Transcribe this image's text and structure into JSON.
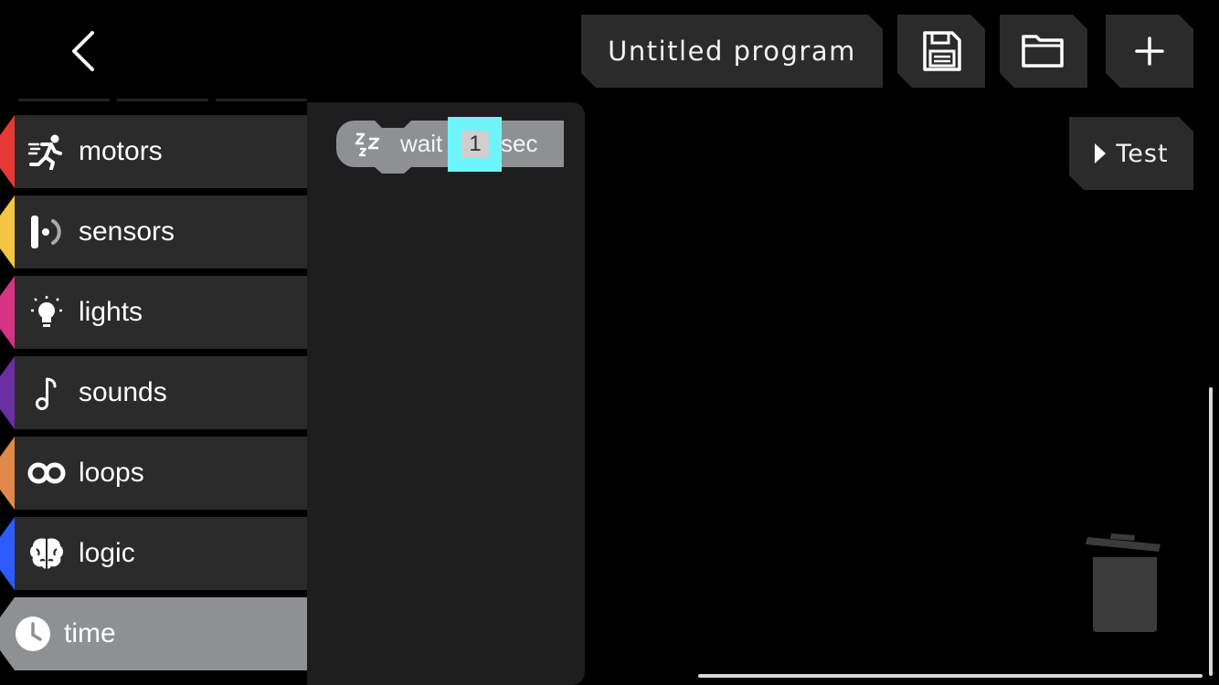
{
  "header": {
    "program_title": "Untitled program",
    "back_icon": "chevron-left-icon",
    "save_icon": "floppy-disk-icon",
    "open_icon": "folder-icon",
    "new_icon": "plus-icon"
  },
  "test_button": {
    "label": "Test",
    "icon": "play-icon"
  },
  "categories": [
    {
      "label": "motors",
      "icon": "running-person-icon",
      "color": "#e53935"
    },
    {
      "label": "sensors",
      "icon": "sensor-icon",
      "color": "#f4c542"
    },
    {
      "label": "lights",
      "icon": "lightbulb-icon",
      "color": "#d63384"
    },
    {
      "label": "sounds",
      "icon": "music-note-icon",
      "color": "#6a2fa0"
    },
    {
      "label": "loops",
      "icon": "infinity-loop-icon",
      "color": "#e0884a"
    },
    {
      "label": "logic",
      "icon": "brain-icon",
      "color": "#2d5bff"
    },
    {
      "label": "time",
      "icon": "clock-icon",
      "color": "#8d9193",
      "active": true
    }
  ],
  "flyout": {
    "blocks": [
      {
        "icon": "sleep-zzz-icon",
        "prefix": "wait",
        "value": "1",
        "suffix": "sec"
      }
    ]
  },
  "colors": {
    "background": "#000000",
    "panel": "#2b2b2b",
    "flyout": "#1e1e1e",
    "block": "#8d9193",
    "field_highlight": "#6ef5fb"
  },
  "trash_icon": "trash-can-icon"
}
